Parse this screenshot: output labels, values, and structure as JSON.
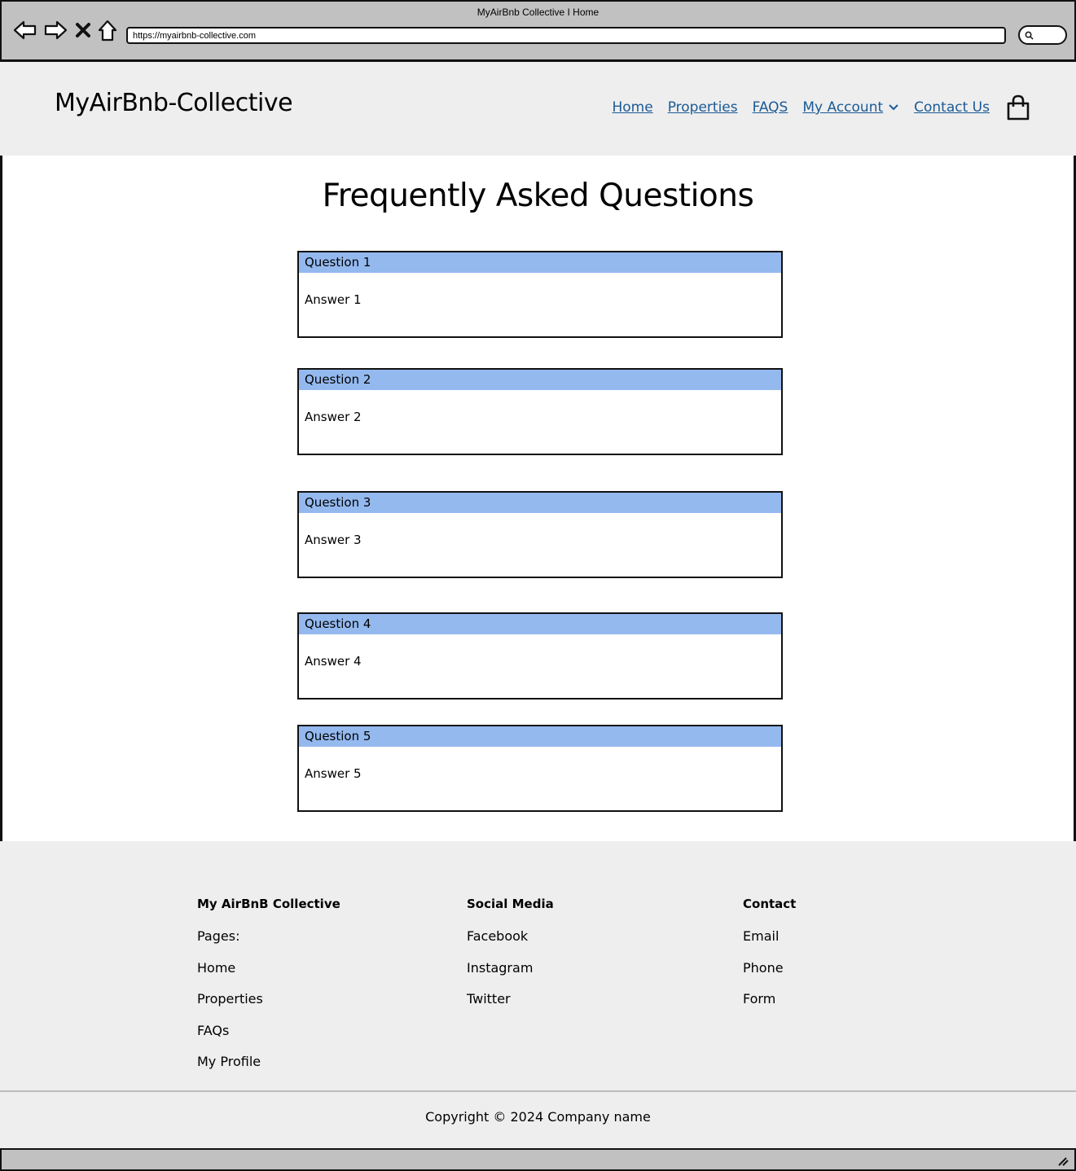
{
  "browser": {
    "window_title": "MyAirBnb Collective I Home",
    "url": "https://myairbnb-collective.com"
  },
  "header": {
    "brand": "MyAirBnb-Collective",
    "nav": {
      "home": "Home",
      "properties": "Properties",
      "faqs": "FAQS",
      "my_account": "My Account",
      "contact_us": "Contact Us"
    },
    "link_color": "#1a5a96"
  },
  "main": {
    "title": "Frequently Asked Questions",
    "faqs": [
      {
        "question": "Question 1",
        "answer": "Answer 1"
      },
      {
        "question": "Question 2",
        "answer": "Answer 2"
      },
      {
        "question": "Question 3",
        "answer": "Answer 3"
      },
      {
        "question": "Question 4",
        "answer": "Answer 4"
      },
      {
        "question": "Question 5",
        "answer": "Answer 5"
      }
    ],
    "question_bar_color": "#94b9ef"
  },
  "footer": {
    "columns": [
      {
        "heading": "My AirBnB Collective",
        "items": [
          "Pages:",
          "Home",
          "Properties",
          "FAQs",
          "My Profile"
        ]
      },
      {
        "heading": "Social Media",
        "items": [
          "Facebook",
          "Instagram",
          "Twitter"
        ]
      },
      {
        "heading": "Contact",
        "items": [
          "Email",
          "Phone",
          "Form"
        ]
      }
    ],
    "copyright": "Copyright © 2024 Company name"
  },
  "icons": {
    "back": "back-arrow-icon",
    "forward": "forward-arrow-icon",
    "stop": "close-icon",
    "home": "home-icon",
    "search": "search-icon",
    "dropdown": "chevron-down-icon",
    "cart": "shopping-bag-icon"
  }
}
